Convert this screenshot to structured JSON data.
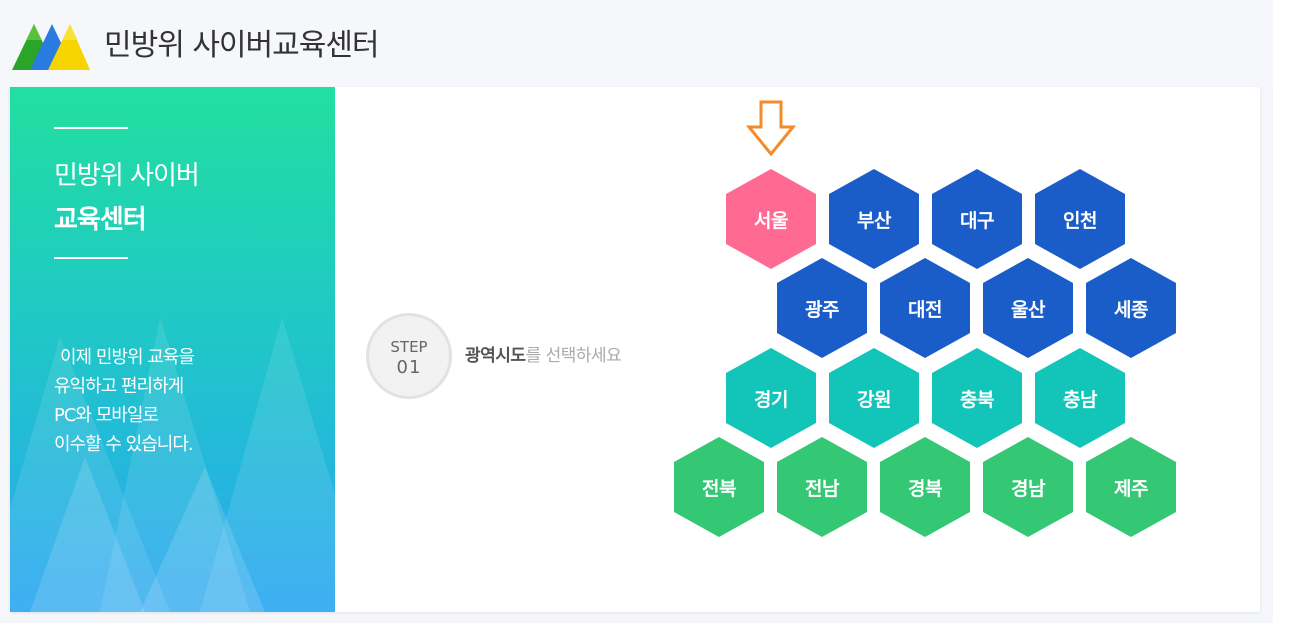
{
  "header": {
    "site_title": "민방위 사이버교육센터"
  },
  "side": {
    "title_line1": "민방위 사이버",
    "title_line2": "교육센터",
    "desc": [
      "이제 민방위 교육을",
      "유익하고 편리하게",
      "PC와 모바일로",
      "이수할 수 있습니다."
    ]
  },
  "step": {
    "label": "STEP",
    "number": "01",
    "emph": "광역시도",
    "rest": "를 선택하세요"
  },
  "colors": {
    "pink": "#ff6a93",
    "blue": "#1a5cc8",
    "teal": "#13c4b9",
    "green": "#34c774"
  },
  "regions": [
    {
      "name": "서울",
      "row": 0,
      "col": 0,
      "color": "pink"
    },
    {
      "name": "부산",
      "row": 0,
      "col": 1,
      "color": "blue"
    },
    {
      "name": "대구",
      "row": 0,
      "col": 2,
      "color": "blue"
    },
    {
      "name": "인천",
      "row": 0,
      "col": 3,
      "color": "blue"
    },
    {
      "name": "광주",
      "row": 1,
      "col": 0,
      "color": "blue"
    },
    {
      "name": "대전",
      "row": 1,
      "col": 1,
      "color": "blue"
    },
    {
      "name": "울산",
      "row": 1,
      "col": 2,
      "color": "blue"
    },
    {
      "name": "세종",
      "row": 1,
      "col": 3,
      "color": "blue"
    },
    {
      "name": "경기",
      "row": 2,
      "col": 0,
      "color": "teal"
    },
    {
      "name": "강원",
      "row": 2,
      "col": 1,
      "color": "teal"
    },
    {
      "name": "충북",
      "row": 2,
      "col": 2,
      "color": "teal"
    },
    {
      "name": "충남",
      "row": 2,
      "col": 3,
      "color": "teal"
    },
    {
      "name": "전북",
      "row": 3,
      "col": 0,
      "color": "green"
    },
    {
      "name": "전남",
      "row": 3,
      "col": 1,
      "color": "green"
    },
    {
      "name": "경북",
      "row": 3,
      "col": 2,
      "color": "green"
    },
    {
      "name": "경남",
      "row": 3,
      "col": 3,
      "color": "green"
    },
    {
      "name": "제주",
      "row": 3,
      "col": 4,
      "color": "green"
    }
  ]
}
